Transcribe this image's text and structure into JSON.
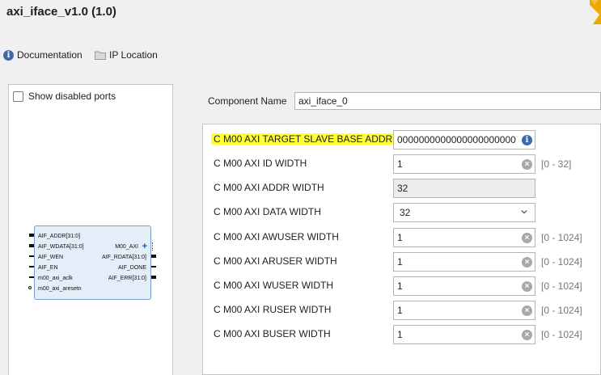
{
  "header": {
    "title": "axi_iface_v1.0 (1.0)",
    "documentation_label": "Documentation",
    "ip_location_label": "IP Location"
  },
  "preview": {
    "show_disabled_label": "Show disabled ports",
    "show_disabled_checked": false,
    "left_ports": [
      "AIF_ADDR[31:0]",
      "AIF_WDATA[31:0]",
      "AIF_WEN",
      "AIF_EN",
      "m00_axi_aclk",
      "m00_axi_aresetn"
    ],
    "right_ports": [
      "M00_AXI",
      "AIF_RDATA[31:0]",
      "AIF_DONE",
      "AIF_ERR[31:0]"
    ]
  },
  "component": {
    "label": "Component Name",
    "value": "axi_iface_0"
  },
  "params": [
    {
      "label": "C M00 AXI TARGET SLAVE BASE ADDR",
      "value": "0000000000000000000000",
      "range": ""
    },
    {
      "label": "C M00 AXI ID WIDTH",
      "value": "1",
      "range": "[0 - 32]"
    },
    {
      "label": "C M00 AXI ADDR WIDTH",
      "value": "32",
      "range": ""
    },
    {
      "label": "C M00 AXI DATA WIDTH",
      "value": "32",
      "range": ""
    },
    {
      "label": "C M00 AXI AWUSER WIDTH",
      "value": "1",
      "range": "[0 - 1024]"
    },
    {
      "label": "C M00 AXI ARUSER WIDTH",
      "value": "1",
      "range": "[0 - 1024]"
    },
    {
      "label": "C M00 AXI WUSER WIDTH",
      "value": "1",
      "range": "[0 - 1024]"
    },
    {
      "label": "C M00 AXI RUSER WIDTH",
      "value": "1",
      "range": "[0 - 1024]"
    },
    {
      "label": "C M00 AXI BUSER WIDTH",
      "value": "1",
      "range": "[0 - 1024]"
    }
  ],
  "colors": {
    "highlight": "#ffff33",
    "accent": "#3d6aa8",
    "block_fill": "#e3eef9",
    "logo": "#f0a800"
  },
  "icons": {
    "documentation": "info-icon",
    "ip_location": "folder-icon",
    "clear": "clear-icon",
    "dropdown": "chevron-down-icon"
  }
}
